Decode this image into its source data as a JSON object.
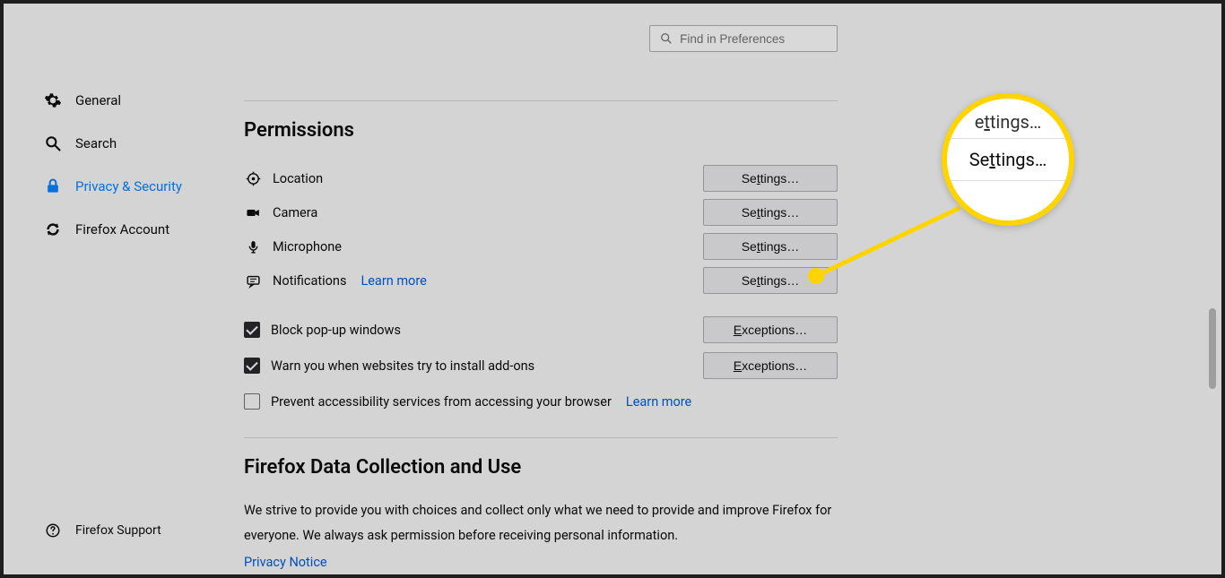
{
  "search": {
    "placeholder": "Find in Preferences"
  },
  "sidebar": {
    "items": [
      {
        "label": "General"
      },
      {
        "label": "Search"
      },
      {
        "label": "Privacy & Security"
      },
      {
        "label": "Firefox Account"
      }
    ],
    "support": "Firefox Support"
  },
  "permissions": {
    "title": "Permissions",
    "rows": [
      {
        "label": "Location",
        "button_pre": "Se",
        "button_u": "t",
        "button_post": "tings…"
      },
      {
        "label": "Camera",
        "button_pre": "Se",
        "button_u": "t",
        "button_post": "tings…"
      },
      {
        "label": "Microphone",
        "button_pre": "Se",
        "button_u": "t",
        "button_post": "tings…"
      },
      {
        "label": "Notifications",
        "learn": "Learn more",
        "button_pre": "Se",
        "button_u": "t",
        "button_post": "tings…"
      }
    ],
    "check_popups": {
      "pre": "",
      "u": "B",
      "post": "lock pop-up windows",
      "button_pre": "",
      "button_u": "E",
      "button_post": "xceptions…"
    },
    "check_addons": {
      "pre": "",
      "u": "W",
      "post": "arn you when websites try to install add-ons",
      "button_pre": "",
      "button_u": "E",
      "button_post": "xceptions…"
    },
    "check_a11y": {
      "pre": "Prevent ",
      "u": "a",
      "post": "ccessibility services from accessing your browser",
      "learn": "Learn more"
    }
  },
  "data_collection": {
    "title": "Firefox Data Collection and Use",
    "description": "We strive to provide you with choices and collect only what we need to provide and improve Firefox for everyone. We always ask permission before receiving personal information.",
    "privacy_notice": "Privacy Notice"
  },
  "callout": {
    "top_pre": "e",
    "top_u": "t",
    "top_post": "tings…",
    "main_pre": "Se",
    "main_u": "t",
    "main_post": "tings…"
  }
}
